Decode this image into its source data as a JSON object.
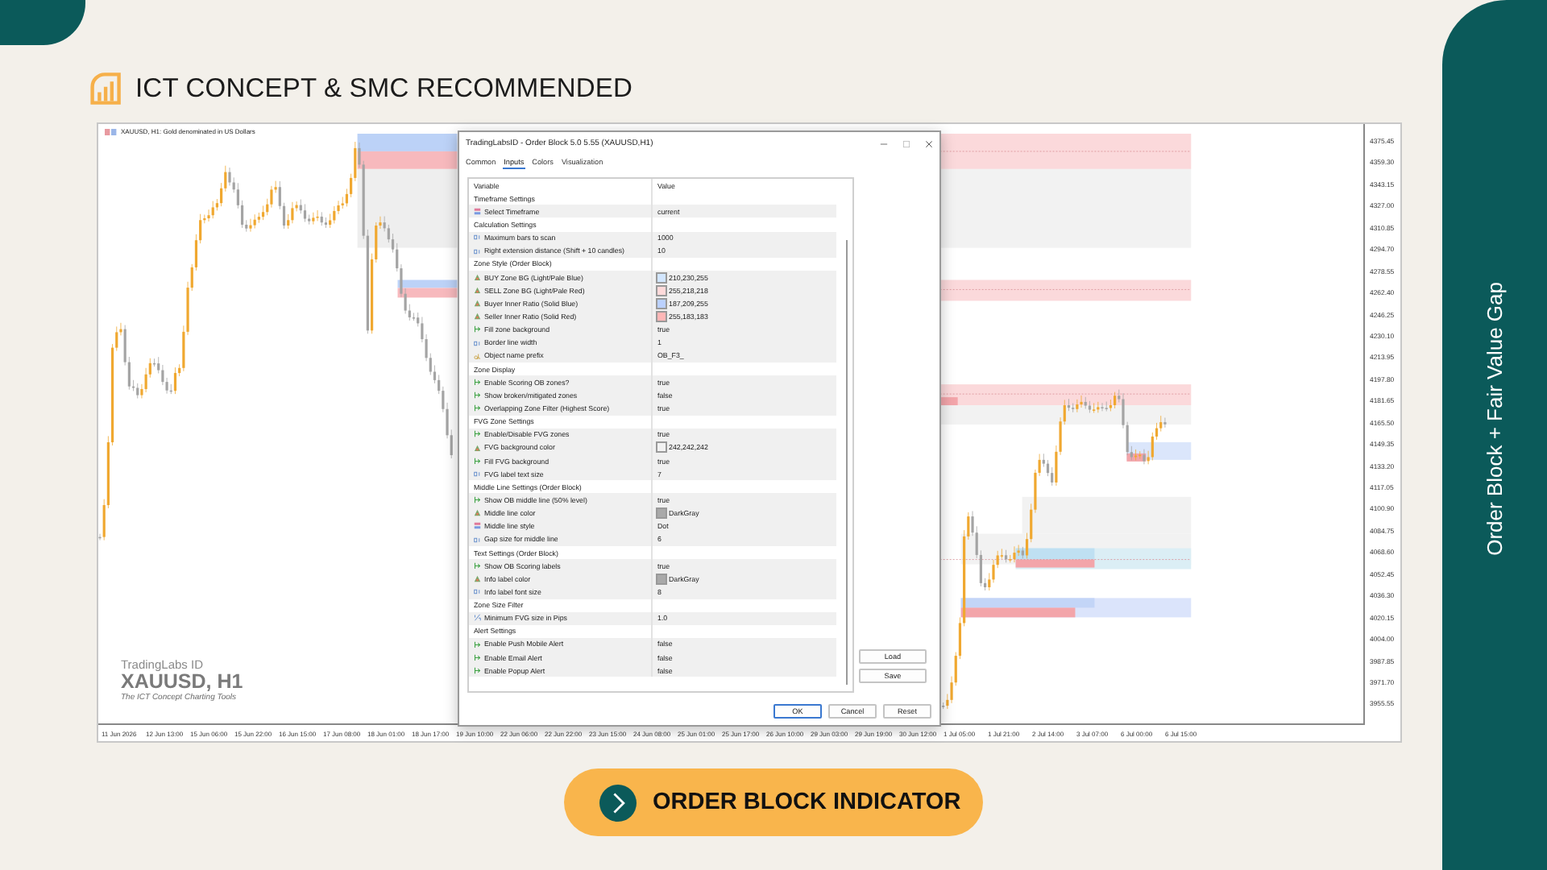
{
  "header": {
    "title": "ICT CONCEPT & SMC RECOMMENDED"
  },
  "side_banner": {
    "text": "Order Block + Fair Value Gap"
  },
  "chart": {
    "legend": "XAUUSD, H1:  Gold denominated in US Dollars",
    "watermark": {
      "brand": "TradingLabs ID",
      "symbol": "XAUUSD, H1",
      "tagline": "The ICT Concept Charting Tools"
    },
    "price_labels": [
      "4375.45",
      "4359.30",
      "4343.15",
      "4327.00",
      "4310.85",
      "4294.70",
      "4278.55",
      "4262.40",
      "4246.25",
      "4230.10",
      "4213.95",
      "4197.80",
      "4181.65",
      "4165.50",
      "4149.35",
      "4133.20",
      "4117.05",
      "4100.90",
      "4084.75",
      "4068.60",
      "4052.45",
      "4036.30",
      "4020.15",
      "4004.00",
      "3987.85",
      "3971.70",
      "3955.55"
    ],
    "time_labels": [
      "11 Jun 2026",
      "12 Jun 13:00",
      "15 Jun 06:00",
      "15 Jun 22:00",
      "16 Jun 15:00",
      "17 Jun 08:00",
      "18 Jun 01:00",
      "18 Jun 17:00",
      "19 Jun 10:00",
      "22 Jun 06:00",
      "22 Jun 22:00",
      "23 Jun 15:00",
      "24 Jun 08:00",
      "25 Jun 01:00",
      "25 Jun 17:00",
      "26 Jun 10:00",
      "29 Jun 03:00",
      "29 Jun 19:00",
      "30 Jun 12:00",
      "1 Jul 05:00",
      "1 Jul 21:00",
      "2 Jul 14:00",
      "3 Jul 07:00",
      "6 Jul 00:00",
      "6 Jul 15:00"
    ]
  },
  "dialog": {
    "title": "TradingLabsID - Order Block 5.0 5.55 (XAUUSD,H1)",
    "tabs": [
      {
        "label": "Common",
        "selected": false
      },
      {
        "label": "Inputs",
        "selected": true
      },
      {
        "label": "Colors",
        "selected": false
      },
      {
        "label": "Visualization",
        "selected": false
      }
    ],
    "columns": [
      "Variable",
      "Value"
    ],
    "rows": [
      {
        "kind": "section",
        "label": "Timeframe Settings"
      },
      {
        "kind": "enum",
        "label": "Select Timeframe",
        "value": "current"
      },
      {
        "kind": "section",
        "label": "Calculation Settings"
      },
      {
        "kind": "int",
        "label": "Maximum bars to scan",
        "value": "1000"
      },
      {
        "kind": "int",
        "label": "Right extension distance (Shift + 10 candles)",
        "value": "10"
      },
      {
        "kind": "section",
        "label": "Zone Style (Order Block)"
      },
      {
        "kind": "color",
        "label": "BUY Zone BG (Light/Pale Blue)",
        "value": "210,230,255",
        "color": "#d2e6ff"
      },
      {
        "kind": "color",
        "label": "SELL Zone BG (Light/Pale Red)",
        "value": "255,218,218",
        "color": "#ffdada"
      },
      {
        "kind": "color",
        "label": "Buyer Inner Ratio (Solid Blue)",
        "value": "187,209,255",
        "color": "#bbd1ff"
      },
      {
        "kind": "color",
        "label": "Seller Inner Ratio (Solid Red)",
        "value": "255,183,183",
        "color": "#ffb7b7"
      },
      {
        "kind": "bool",
        "label": "Fill zone background",
        "value": "true"
      },
      {
        "kind": "int",
        "label": "Border line width",
        "value": "1"
      },
      {
        "kind": "string",
        "label": "Object name prefix",
        "value": "OB_F3_"
      },
      {
        "kind": "section",
        "label": "Zone Display"
      },
      {
        "kind": "bool",
        "label": "Enable Scoring OB zones?",
        "value": "true"
      },
      {
        "kind": "bool",
        "label": "Show broken/mitigated zones",
        "value": "false"
      },
      {
        "kind": "bool",
        "label": "Overlapping Zone Filter (Highest Score)",
        "value": "true"
      },
      {
        "kind": "section",
        "label": "FVG Zone Settings"
      },
      {
        "kind": "bool",
        "label": "Enable/Disable FVG zones",
        "value": "true"
      },
      {
        "kind": "color",
        "label": "FVG background color",
        "value": "242,242,242",
        "color": "#f2f2f2"
      },
      {
        "kind": "bool",
        "label": "Fill FVG background",
        "value": "true"
      },
      {
        "kind": "int",
        "label": "FVG label text size",
        "value": "7"
      },
      {
        "kind": "section",
        "label": "Middle Line Settings (Order Block)"
      },
      {
        "kind": "bool",
        "label": "Show OB middle line (50% level)",
        "value": "true"
      },
      {
        "kind": "color",
        "label": "Middle line color",
        "value": "DarkGray",
        "color": "#a9a9a9"
      },
      {
        "kind": "enum",
        "label": "Middle line style",
        "value": "Dot"
      },
      {
        "kind": "int",
        "label": "Gap size for middle line",
        "value": "6"
      },
      {
        "kind": "section",
        "label": "Text Settings (Order Block)"
      },
      {
        "kind": "bool",
        "label": "Show OB Scoring labels",
        "value": "true"
      },
      {
        "kind": "color",
        "label": "Info label color",
        "value": "DarkGray",
        "color": "#a9a9a9"
      },
      {
        "kind": "int",
        "label": "Info label font size",
        "value": "8"
      },
      {
        "kind": "section",
        "label": "Zone Size Filter"
      },
      {
        "kind": "double",
        "label": "Minimum FVG size in Pips",
        "value": "1.0"
      },
      {
        "kind": "section",
        "label": "Alert Settings"
      },
      {
        "kind": "bool",
        "label": "Enable Push Mobile Alert",
        "value": "false"
      },
      {
        "kind": "bool",
        "label": "Enable Email Alert",
        "value": "false"
      },
      {
        "kind": "bool",
        "label": "Enable Popup Alert",
        "value": "false"
      }
    ],
    "side_buttons": [
      "Load",
      "Save"
    ],
    "buttons": [
      {
        "label": "OK",
        "default": true
      },
      {
        "label": "Cancel",
        "default": false
      },
      {
        "label": "Reset",
        "default": false
      }
    ]
  },
  "cta": {
    "label": "ORDER BLOCK INDICATOR"
  }
}
